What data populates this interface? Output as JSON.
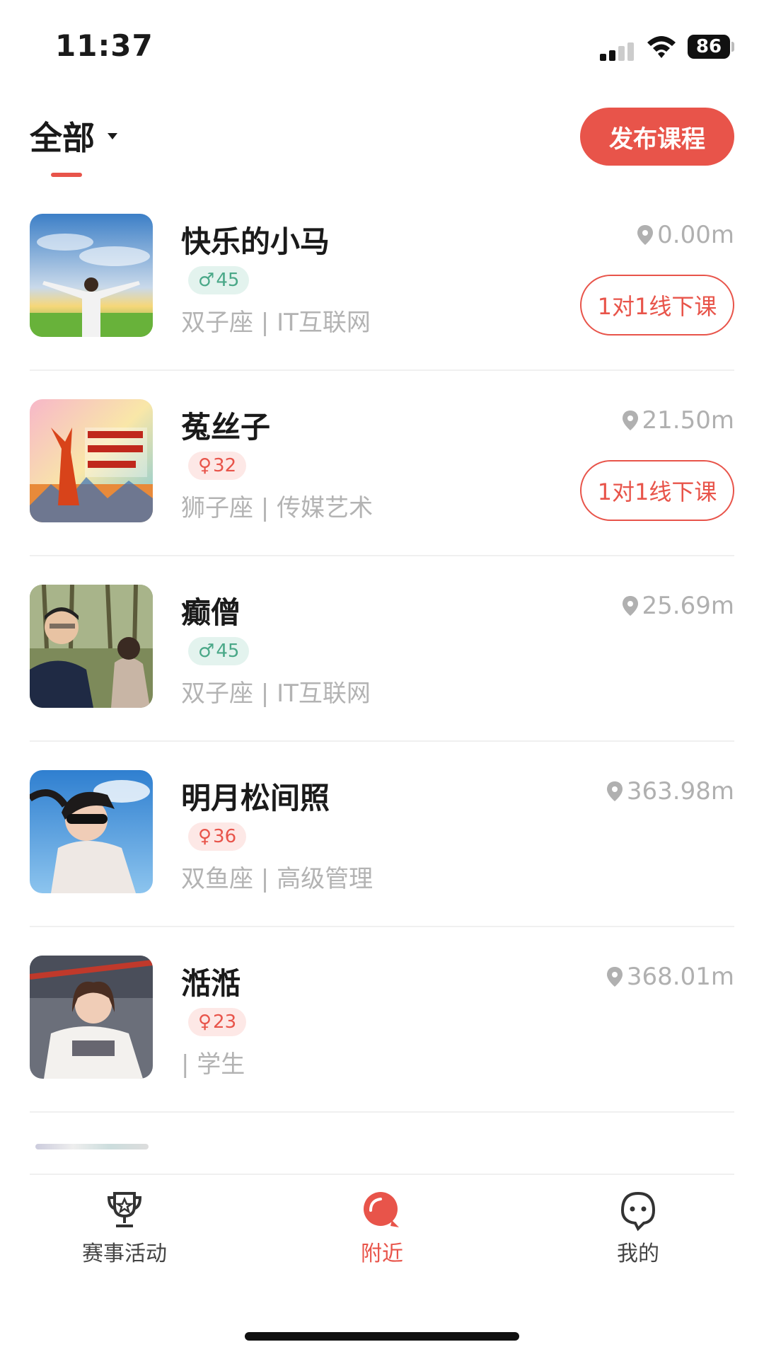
{
  "status_bar": {
    "time": "11:37",
    "battery": "86"
  },
  "header": {
    "filter_label": "全部",
    "publish_label": "发布课程"
  },
  "items": [
    {
      "name": "快乐的小马",
      "gender": "male",
      "gender_symbol": "♂",
      "age": "45",
      "info": "双子座 | IT互联网",
      "distance": "0.00m",
      "course_label": "1对1线下课",
      "has_course": true
    },
    {
      "name": "菟丝子",
      "gender": "female",
      "gender_symbol": "♀",
      "age": "32",
      "info": "狮子座 | 传媒艺术",
      "distance": "21.50m",
      "course_label": "1对1线下课",
      "has_course": true
    },
    {
      "name": "癫僧",
      "gender": "male",
      "gender_symbol": "♂",
      "age": "45",
      "info": "双子座 | IT互联网",
      "distance": "25.69m",
      "has_course": false
    },
    {
      "name": "明月松间照",
      "gender": "female",
      "gender_symbol": "♀",
      "age": "36",
      "info": "双鱼座 | 高级管理",
      "distance": "363.98m",
      "has_course": false
    },
    {
      "name": "湉湉",
      "gender": "female",
      "gender_symbol": "♀",
      "age": "23",
      "info": "| 学生",
      "distance": "368.01m",
      "has_course": false
    }
  ],
  "tabs": [
    {
      "label": "赛事活动",
      "icon": "trophy-icon",
      "active": false
    },
    {
      "label": "附近",
      "icon": "nearby-icon",
      "active": true
    },
    {
      "label": "我的",
      "icon": "profile-icon",
      "active": false
    }
  ],
  "colors": {
    "accent": "#e8544a",
    "male_badge": "#4aa888",
    "female_badge": "#e8544a"
  }
}
